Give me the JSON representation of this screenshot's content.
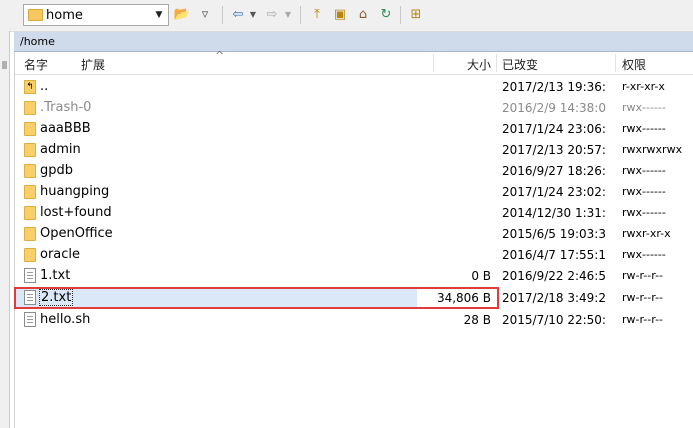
{
  "toolbar": {
    "location": "home",
    "icons": [
      "dropdown-arrow-icon",
      "open-folder-icon",
      "filter-icon",
      "back-icon",
      "back-dropdown-icon",
      "forward-icon",
      "forward-dropdown-icon",
      "parent-folder-icon",
      "root-folder-icon",
      "home-icon",
      "refresh-icon",
      "tree-icon"
    ]
  },
  "path": "/home",
  "columns": {
    "name": "名字",
    "ext": "扩展",
    "size": "大小",
    "modified": "已改变",
    "perms": "权限"
  },
  "rows": [
    {
      "name": "..",
      "size": "",
      "date": "2017/2/13 19:36:...",
      "perm": "r-xr-xr-x",
      "type": "up"
    },
    {
      "name": ".Trash-0",
      "size": "",
      "date": "2016/2/9 14:38:06",
      "perm": "rwx------",
      "type": "folder"
    },
    {
      "name": "aaaBBB",
      "size": "",
      "date": "2017/1/24 23:06:...",
      "perm": "rwx------",
      "type": "folder"
    },
    {
      "name": "admin",
      "size": "",
      "date": "2017/2/13 20:57:...",
      "perm": "rwxrwxrwx",
      "type": "folder"
    },
    {
      "name": "gpdb",
      "size": "",
      "date": "2016/9/27 18:26:...",
      "perm": "rwx------",
      "type": "folder"
    },
    {
      "name": "huangping",
      "size": "",
      "date": "2017/1/24 23:02:...",
      "perm": "rwx------",
      "type": "folder"
    },
    {
      "name": "lost+found",
      "size": "",
      "date": "2014/12/30 1:31:...",
      "perm": "rwx------",
      "type": "folder"
    },
    {
      "name": "OpenOffice",
      "size": "",
      "date": "2015/6/5 19:03:38",
      "perm": "rwxr-xr-x",
      "type": "folder"
    },
    {
      "name": "oracle",
      "size": "",
      "date": "2016/4/7 17:55:14",
      "perm": "rwx------",
      "type": "folder"
    },
    {
      "name": "1.txt",
      "size": "0 B",
      "date": "2016/9/22 2:46:59",
      "perm": "rw-r--r--",
      "type": "file"
    },
    {
      "name": "2.txt",
      "size": "34,806 B",
      "date": "2017/2/18 3:49:23",
      "perm": "rw-r--r--",
      "type": "file"
    },
    {
      "name": "hello.sh",
      "size": "28 B",
      "date": "2015/7/10 22:50:...",
      "perm": "rw-r--r--",
      "type": "file"
    }
  ],
  "selected_row": "2.txt",
  "colors": {
    "highlight": "#e23b3b",
    "pathbar": "#cfdaea",
    "selection": "#dbe8f8"
  }
}
